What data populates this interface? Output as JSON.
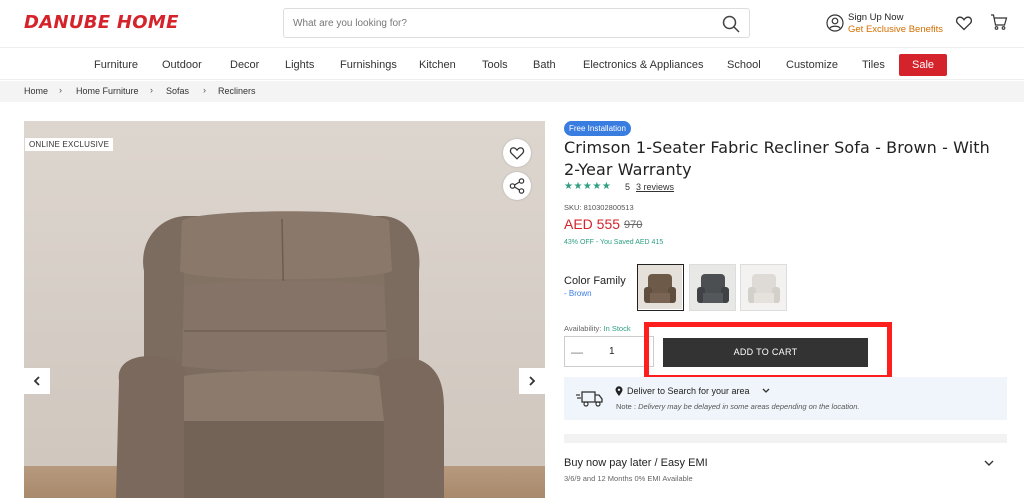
{
  "header": {
    "logo": "DANUBE HOME",
    "search_placeholder": "What are you looking for?",
    "signup_line1": "Sign Up Now",
    "signup_line2": "Get Exclusive Benefits"
  },
  "nav": {
    "items": [
      "Furniture",
      "Outdoor",
      "Decor",
      "Lights",
      "Furnishings",
      "Kitchen",
      "Tools",
      "Bath",
      "Electronics & Appliances",
      "School",
      "Customize",
      "Tiles"
    ],
    "sale": "Sale"
  },
  "breadcrumb": [
    "Home",
    "Home Furniture",
    "Sofas",
    "Recliners"
  ],
  "gallery": {
    "badge": "ONLINE EXCLUSIVE"
  },
  "product": {
    "pill": "Free Installation",
    "title": "Crimson 1-Seater Fabric Recliner Sofa - Brown - With 2-Year Warranty",
    "stars": "★★★★★",
    "rating": "5",
    "reviews": "3 reviews",
    "sku": "SKU: 810302800513",
    "price": "AED 555",
    "old_price": "970",
    "saved": "43% OFF - You Saved AED 415",
    "color_label": "Color Family",
    "color_value": "- Brown",
    "availability_label": "Availability:",
    "availability_value": "In Stock",
    "qty_minus": "—",
    "qty": "1",
    "add_to_cart": "ADD TO CART"
  },
  "delivery": {
    "line": "Deliver to Search for your area",
    "note_label": "Note :",
    "note_text": "Delivery may be delayed in some areas depending on the location."
  },
  "emi": {
    "title": "Buy now pay later / Easy EMI",
    "subtitle": "3/6/9 and 12 Months 0% EMI Available"
  },
  "colors": {
    "brand_red": "#d4232a",
    "accent_orange": "#d46f00",
    "accent_green": "#2e9e83",
    "accent_blue": "#3a7de0",
    "highlight_red": "#ff1e1e"
  }
}
